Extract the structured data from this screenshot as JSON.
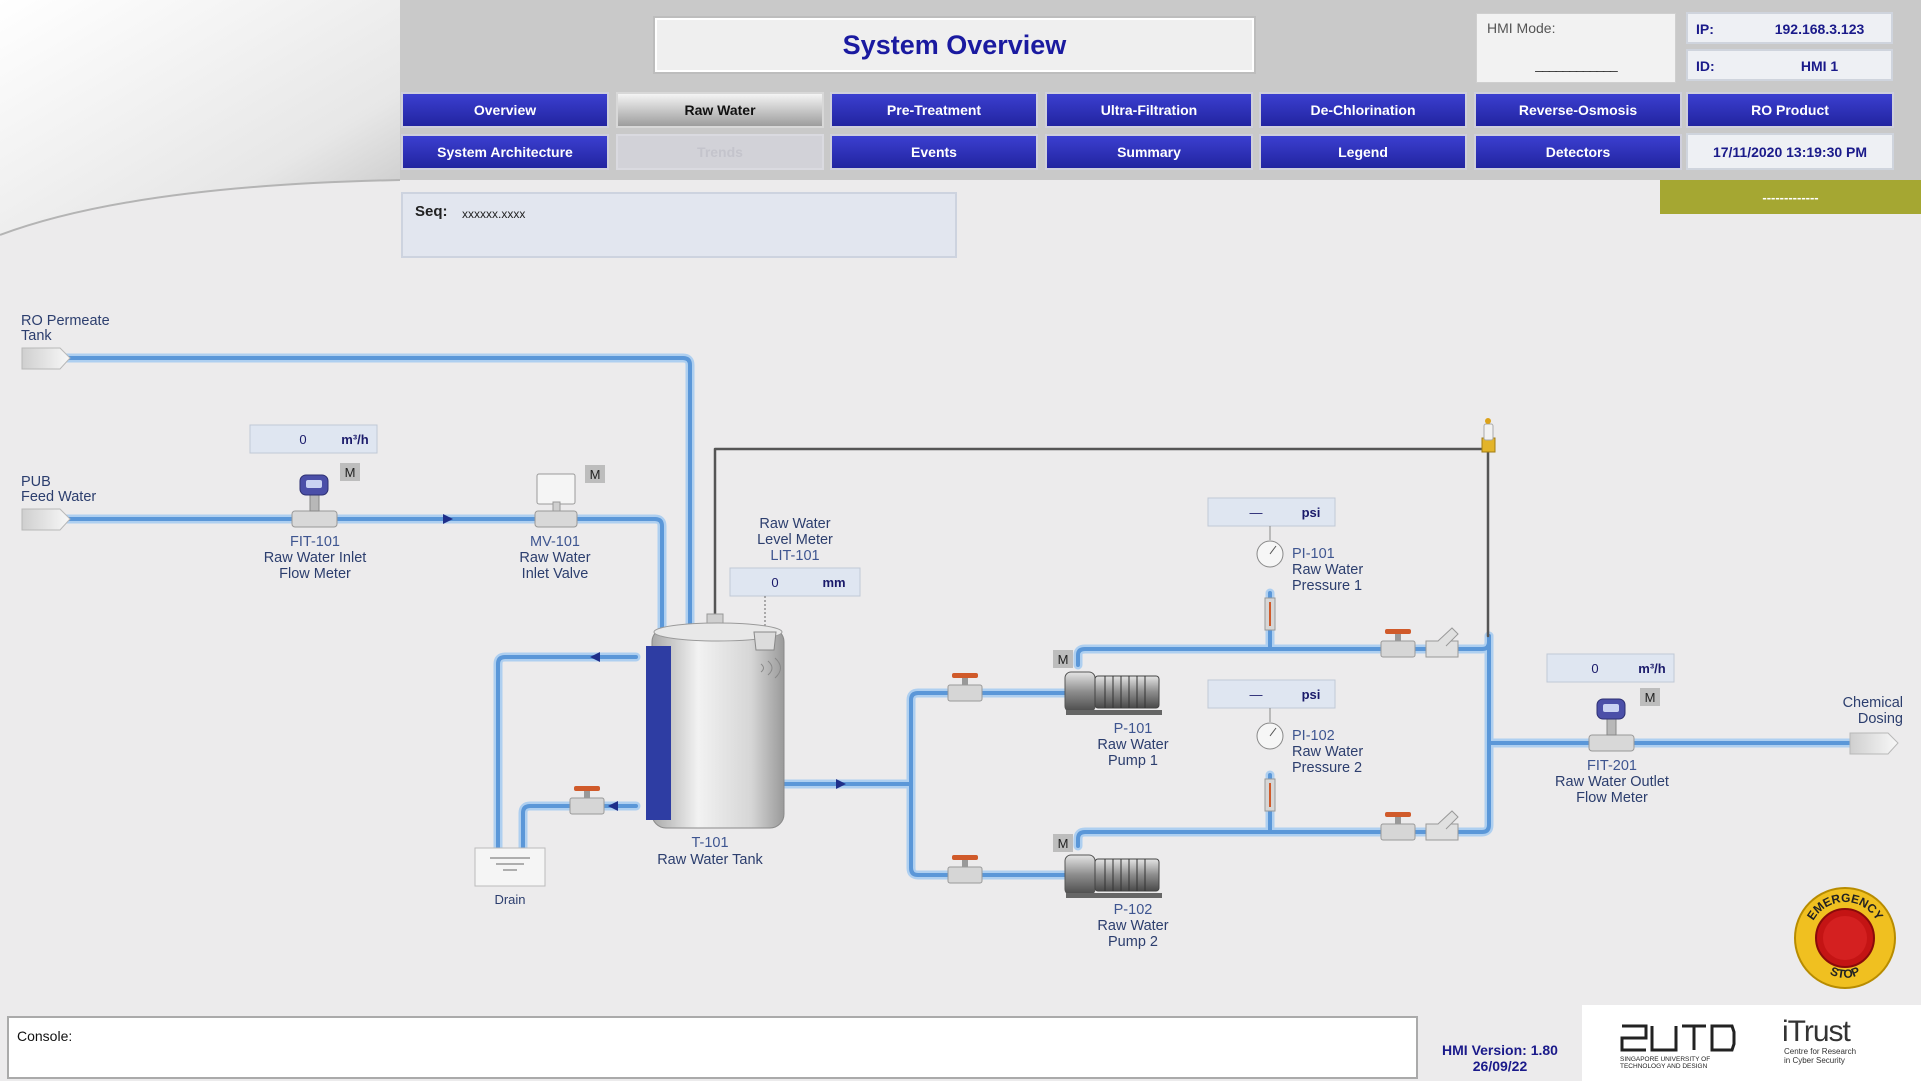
{
  "header": {
    "title": "System Overview",
    "hmi_mode_label": "HMI Mode:",
    "hmi_mode_value": "____________",
    "ip_label": "IP:",
    "ip_value": "192.168.3.123",
    "id_label": "ID:",
    "id_value": "HMI 1",
    "datetime": "17/11/2020 13:19:30 PM",
    "status": "-------------"
  },
  "nav": {
    "row1": [
      "Overview",
      "Raw Water",
      "Pre-Treatment",
      "Ultra-Filtration",
      "De-Chlorination",
      "Reverse-Osmosis",
      "RO Product"
    ],
    "row2": [
      "System Architecture",
      "Trends",
      "Events",
      "Summary",
      "Legend",
      "Detectors"
    ],
    "active": "Raw Water",
    "disabled": "Trends"
  },
  "seq": {
    "label": "Seq:",
    "value": "xxxxxx.xxxx"
  },
  "diagram": {
    "ro_permeate": [
      "RO Permeate",
      "Tank"
    ],
    "pub_feed": [
      "PUB",
      "Feed Water"
    ],
    "fit101": {
      "value": "0",
      "unit": "m³/h",
      "mode": "M",
      "tag": "FIT-101",
      "desc": [
        "Raw Water Inlet",
        "Flow Meter"
      ]
    },
    "mv101": {
      "mode": "M",
      "tag": "MV-101",
      "desc": [
        "Raw Water",
        "Inlet Valve"
      ]
    },
    "lit101": {
      "title": [
        "Raw Water",
        "Level Meter"
      ],
      "tag": "LIT-101",
      "value": "0",
      "unit": "mm"
    },
    "t101": {
      "tag": "T-101",
      "desc": "Raw Water Tank"
    },
    "drain": "Drain",
    "p101": {
      "mode": "M",
      "tag": "P-101",
      "desc": [
        "Raw Water",
        "Pump 1"
      ]
    },
    "p102": {
      "mode": "M",
      "tag": "P-102",
      "desc": [
        "Raw Water",
        "Pump 2"
      ]
    },
    "pi101": {
      "value": "—",
      "unit": "psi",
      "tag": "PI-101",
      "desc": [
        "Raw Water",
        "Pressure 1"
      ]
    },
    "pi102": {
      "value": "—",
      "unit": "psi",
      "tag": "PI-102",
      "desc": [
        "Raw Water",
        "Pressure 2"
      ]
    },
    "fit201": {
      "value": "0",
      "unit": "m³/h",
      "mode": "M",
      "tag": "FIT-201",
      "desc": [
        "Raw Water Outlet",
        "Flow Meter"
      ]
    },
    "chemical": [
      "Chemical",
      "Dosing"
    ]
  },
  "estop": {
    "top": "EMERGENCY",
    "bottom": "STOP"
  },
  "console": {
    "label": "Console:"
  },
  "version": {
    "label": "HMI Version: 1.80",
    "date": "26/09/22"
  },
  "logos": {
    "sutd_mark": "SUTD",
    "sutd_sub": [
      "SINGAPORE UNIVERSITY OF",
      "TECHNOLOGY AND DESIGN"
    ],
    "itrust": "iTrust",
    "itrust_sub": [
      "Centre for Research",
      "in Cyber Security"
    ]
  },
  "colors": {
    "nav_blue": "#2a2db8",
    "pipe_blue": "#7fb6e6",
    "title_blue": "#1a1aa0",
    "status_olive": "#a5a732"
  }
}
